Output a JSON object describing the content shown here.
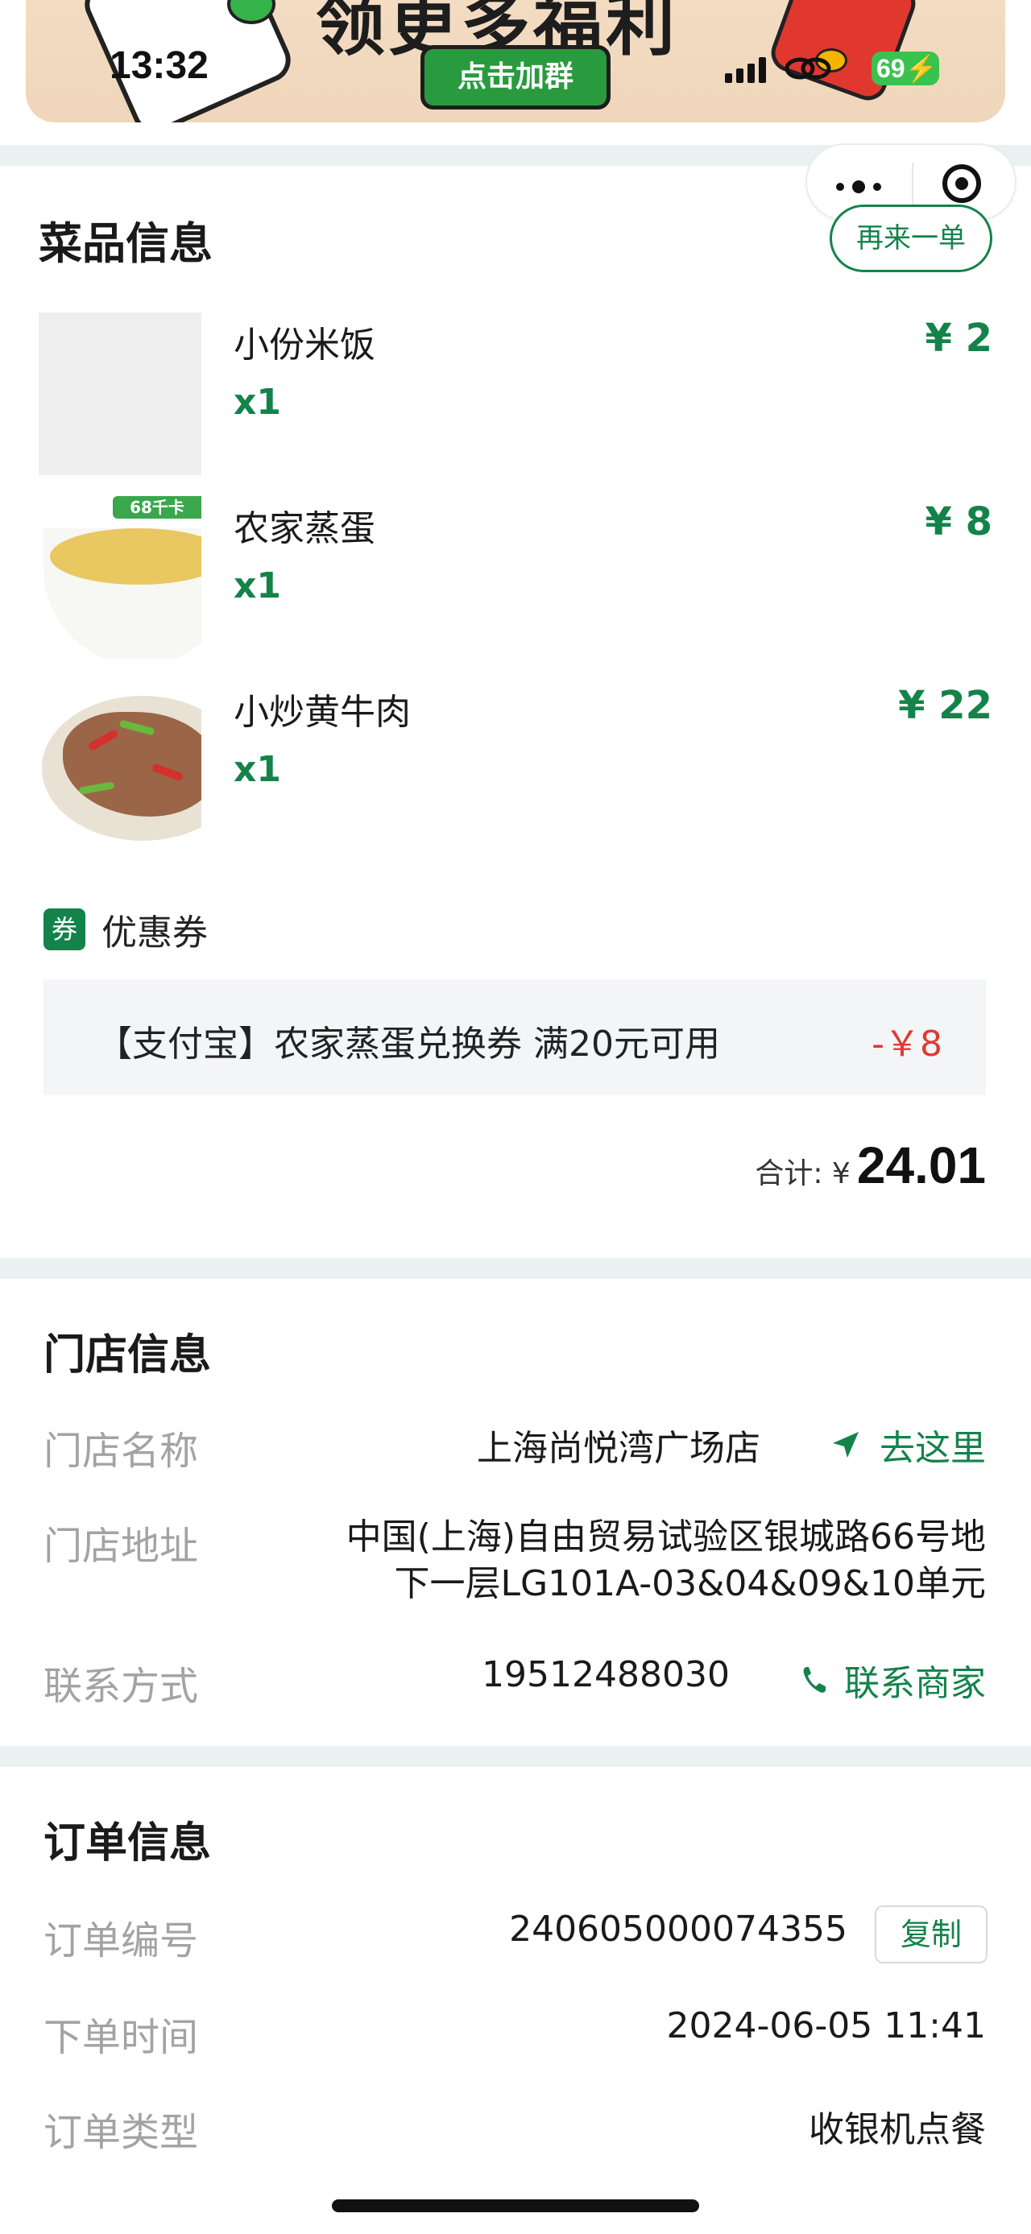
{
  "status_bar": {
    "time": "13:32",
    "battery": "69"
  },
  "banner": {
    "title": "领更多福利",
    "button_label": "点击加群"
  },
  "dishes": {
    "title": "菜品信息",
    "reorder_label": "再来一单",
    "items": [
      {
        "name": "小份米饭",
        "qty": "x1",
        "price": "¥ 2"
      },
      {
        "name": "农家蒸蛋",
        "qty": "x1",
        "price": "¥ 8",
        "tag": "68千卡"
      },
      {
        "name": "小炒黄牛肉",
        "qty": "x1",
        "price": "¥ 22"
      }
    ]
  },
  "coupon": {
    "icon_text": "券",
    "label": "优惠券",
    "text": "【支付宝】农家蒸蛋兑换券 满20元可用",
    "amount": "-￥8"
  },
  "total": {
    "label": "合计: ¥",
    "value": "24.01"
  },
  "store": {
    "title": "门店信息",
    "name_label": "门店名称",
    "name": "上海尚悦湾广场店",
    "go_label": "去这里",
    "address_label": "门店地址",
    "address_line1": "中国(上海)自由贸易试验区银城路66号地",
    "address_line2": "下一层LG101A-03&04&09&10单元",
    "contact_label": "联系方式",
    "phone": "19512488030",
    "contact_link": "联系商家"
  },
  "order": {
    "title": "订单信息",
    "number_label": "订单编号",
    "number": "240605000074355",
    "copy_label": "复制",
    "time_label": "下单时间",
    "time": "2024-06-05 11:41",
    "type_label": "订单类型",
    "type": "收银机点餐"
  },
  "colors": {
    "accent": "#13834a",
    "discount": "#e03a33",
    "band": "#eaf1f0"
  }
}
